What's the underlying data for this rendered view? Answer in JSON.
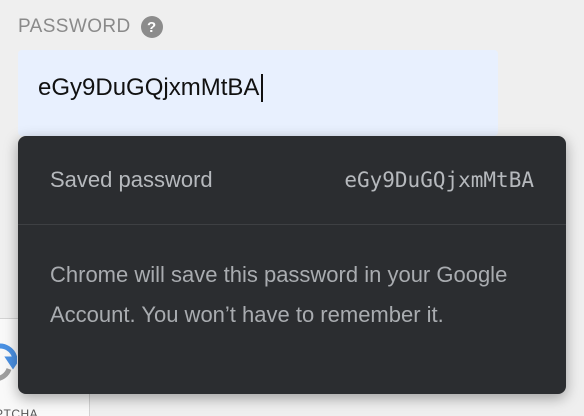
{
  "field": {
    "label": "PASSWORD",
    "help_icon": "?",
    "value": "eGy9DuGQjxmMtBA"
  },
  "popup": {
    "saved_label": "Saved password",
    "saved_value": "eGy9DuGQjxmMtBA",
    "note": "Chrome will save this password in your Google Account. You won’t have to remember it."
  },
  "background": {
    "recaptcha_fragment_text": "PTCHA"
  },
  "colors": {
    "input_bg": "#e8f0fe",
    "popup_bg": "#2b2d30",
    "popup_text": "#b6b9bd",
    "page_bg": "#efefef"
  }
}
